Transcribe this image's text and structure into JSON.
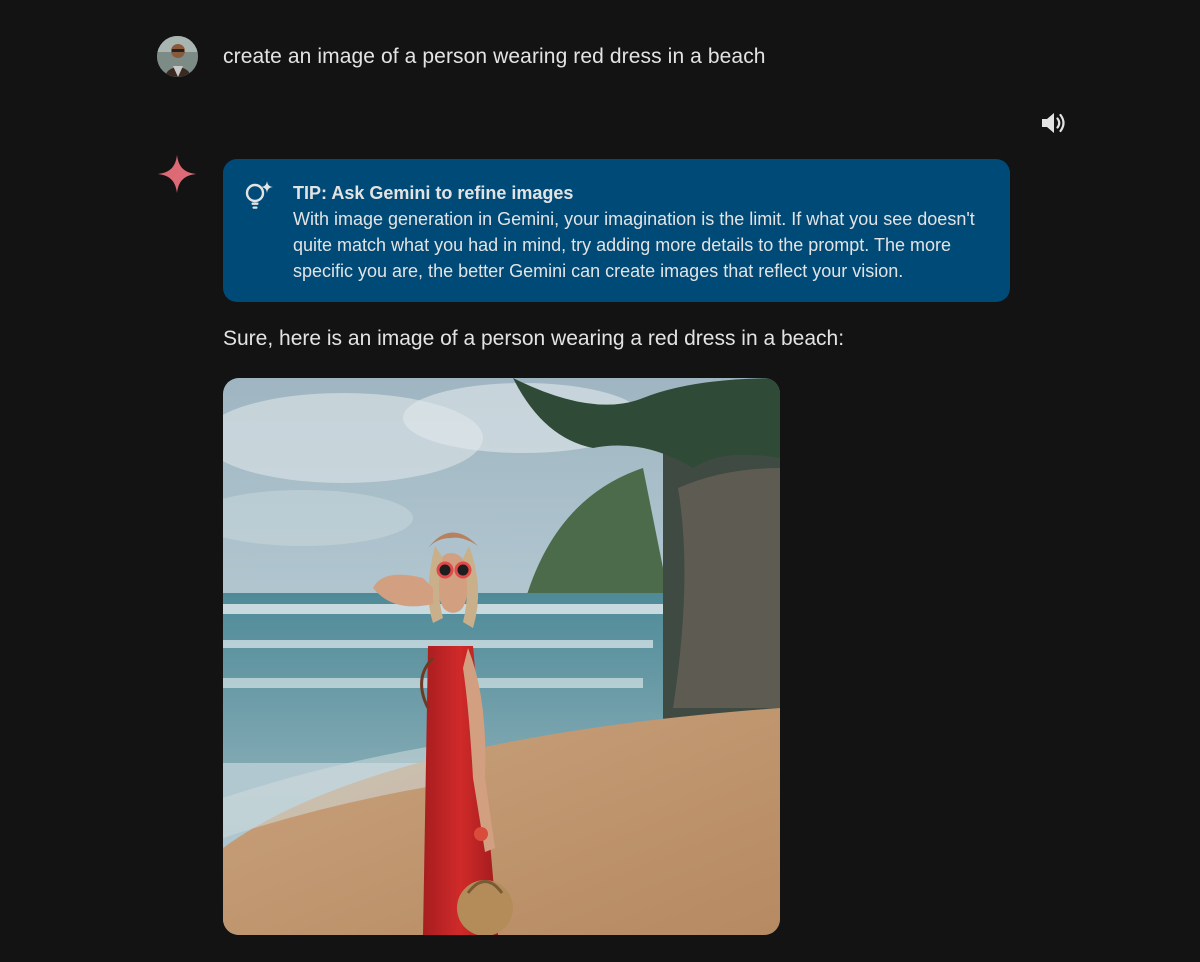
{
  "user": {
    "prompt": "create an image of a person wearing red dress in a beach"
  },
  "controls": {
    "speaker_icon": "volume-up-icon"
  },
  "tip": {
    "icon": "lightbulb-sparkle-icon",
    "title": "TIP: Ask Gemini to refine images",
    "body": "With image generation in Gemini, your imagination is the limit. If what you see doesn't quite match what you had in mind, try adding more details to the prompt. The more specific you are, the better Gemini can create images that reflect your vision."
  },
  "response": {
    "text": "Sure, here is an image of a person wearing a red dress in a beach:"
  },
  "colors": {
    "background": "#131314",
    "tip_card": "#004a77",
    "text": "#e3e3e3"
  }
}
